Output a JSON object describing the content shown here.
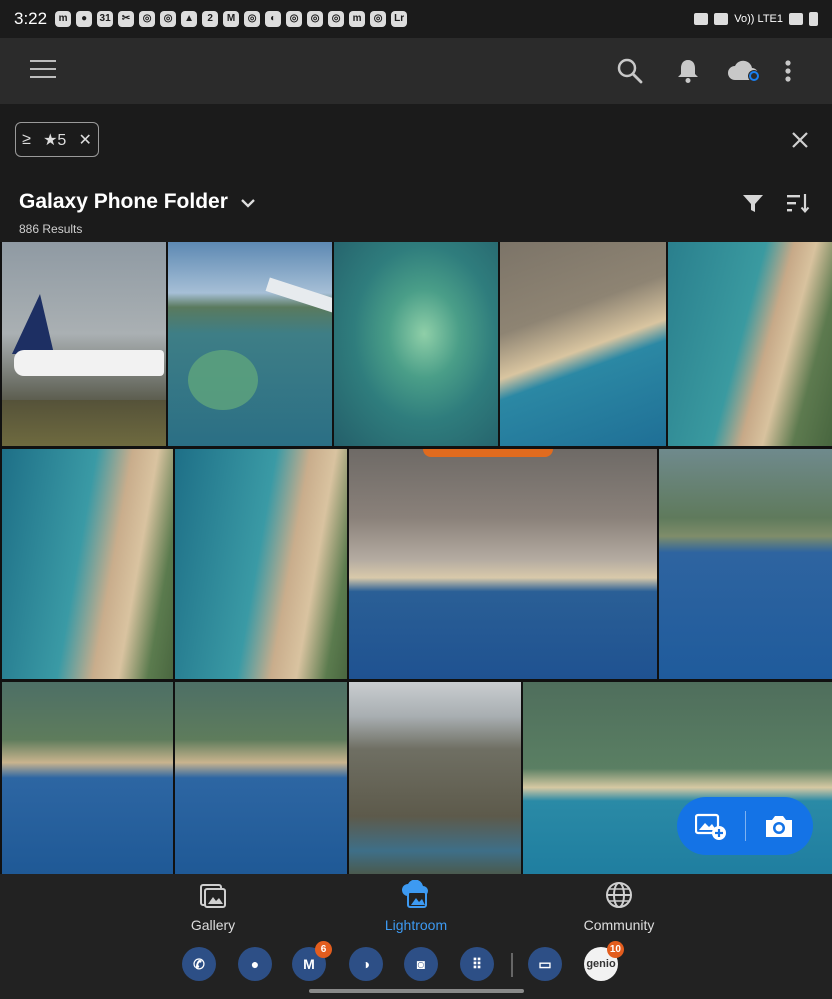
{
  "status_bar": {
    "time": "3:22",
    "notification_icons": [
      "messenger-icon",
      "profile-icon",
      "calendar-icon",
      "capcut-icon",
      "instagram-icon",
      "instagram-icon",
      "bell-icon",
      "calendar-icon",
      "gmail-icon",
      "instagram-icon",
      "ring-icon",
      "instagram-icon",
      "instagram-icon",
      "instagram-icon",
      "messenger-icon",
      "instagram-icon",
      "lightroom-icon"
    ],
    "calendar_day": "31",
    "calendar_day_2": "2",
    "lightroom_badge": "Lr",
    "network": "Vo)) LTE1"
  },
  "app_bar": {
    "icons": [
      "menu-icon",
      "search-icon",
      "bell-icon",
      "cloud-sync-icon",
      "more-vert-icon"
    ]
  },
  "filter": {
    "chip_op": "≥",
    "chip_star": "★",
    "chip_value": "5",
    "chip_remove": "✕"
  },
  "folder": {
    "title": "Galaxy Phone Folder",
    "results": "886 Results"
  },
  "photos": [
    {
      "id": "p1",
      "theme": "airport"
    },
    {
      "id": "p2",
      "theme": "wing"
    },
    {
      "id": "p3",
      "theme": "shoal"
    },
    {
      "id": "p4",
      "theme": "beach-town"
    },
    {
      "id": "p5",
      "theme": "beach"
    },
    {
      "id": "p6",
      "theme": "beach"
    },
    {
      "id": "p7",
      "theme": "beach"
    },
    {
      "id": "p8",
      "theme": "suburb"
    },
    {
      "id": "p9",
      "theme": "bay"
    },
    {
      "id": "p10",
      "theme": "bay"
    },
    {
      "id": "p11",
      "theme": "bay"
    },
    {
      "id": "p12",
      "theme": "city-haze"
    },
    {
      "id": "p13",
      "theme": "cliff"
    }
  ],
  "fab": {
    "icons": [
      "add-photo-icon",
      "camera-icon"
    ]
  },
  "bottom_nav": {
    "items": [
      {
        "label": "Gallery",
        "icon": "gallery-icon",
        "active": false
      },
      {
        "label": "Lightroom",
        "icon": "lightroom-cloud-icon",
        "active": true
      },
      {
        "label": "Community",
        "icon": "globe-icon",
        "active": false
      }
    ]
  },
  "dock": {
    "apps": [
      {
        "icon": "phone-icon",
        "badge": ""
      },
      {
        "icon": "messages-icon",
        "badge": ""
      },
      {
        "icon": "gmail-icon",
        "badge": "6"
      },
      {
        "icon": "browser-icon",
        "badge": ""
      },
      {
        "icon": "camera-icon",
        "badge": ""
      },
      {
        "icon": "apps-grid-icon",
        "badge": ""
      },
      {
        "icon": "recent-app-icon",
        "badge": ""
      },
      {
        "icon": "genio-icon",
        "badge": "10"
      }
    ],
    "genio_label": "genio"
  },
  "colors": {
    "accent": "#1473e6",
    "active_nav": "#3d9af2",
    "badge": "#e35d1e"
  }
}
